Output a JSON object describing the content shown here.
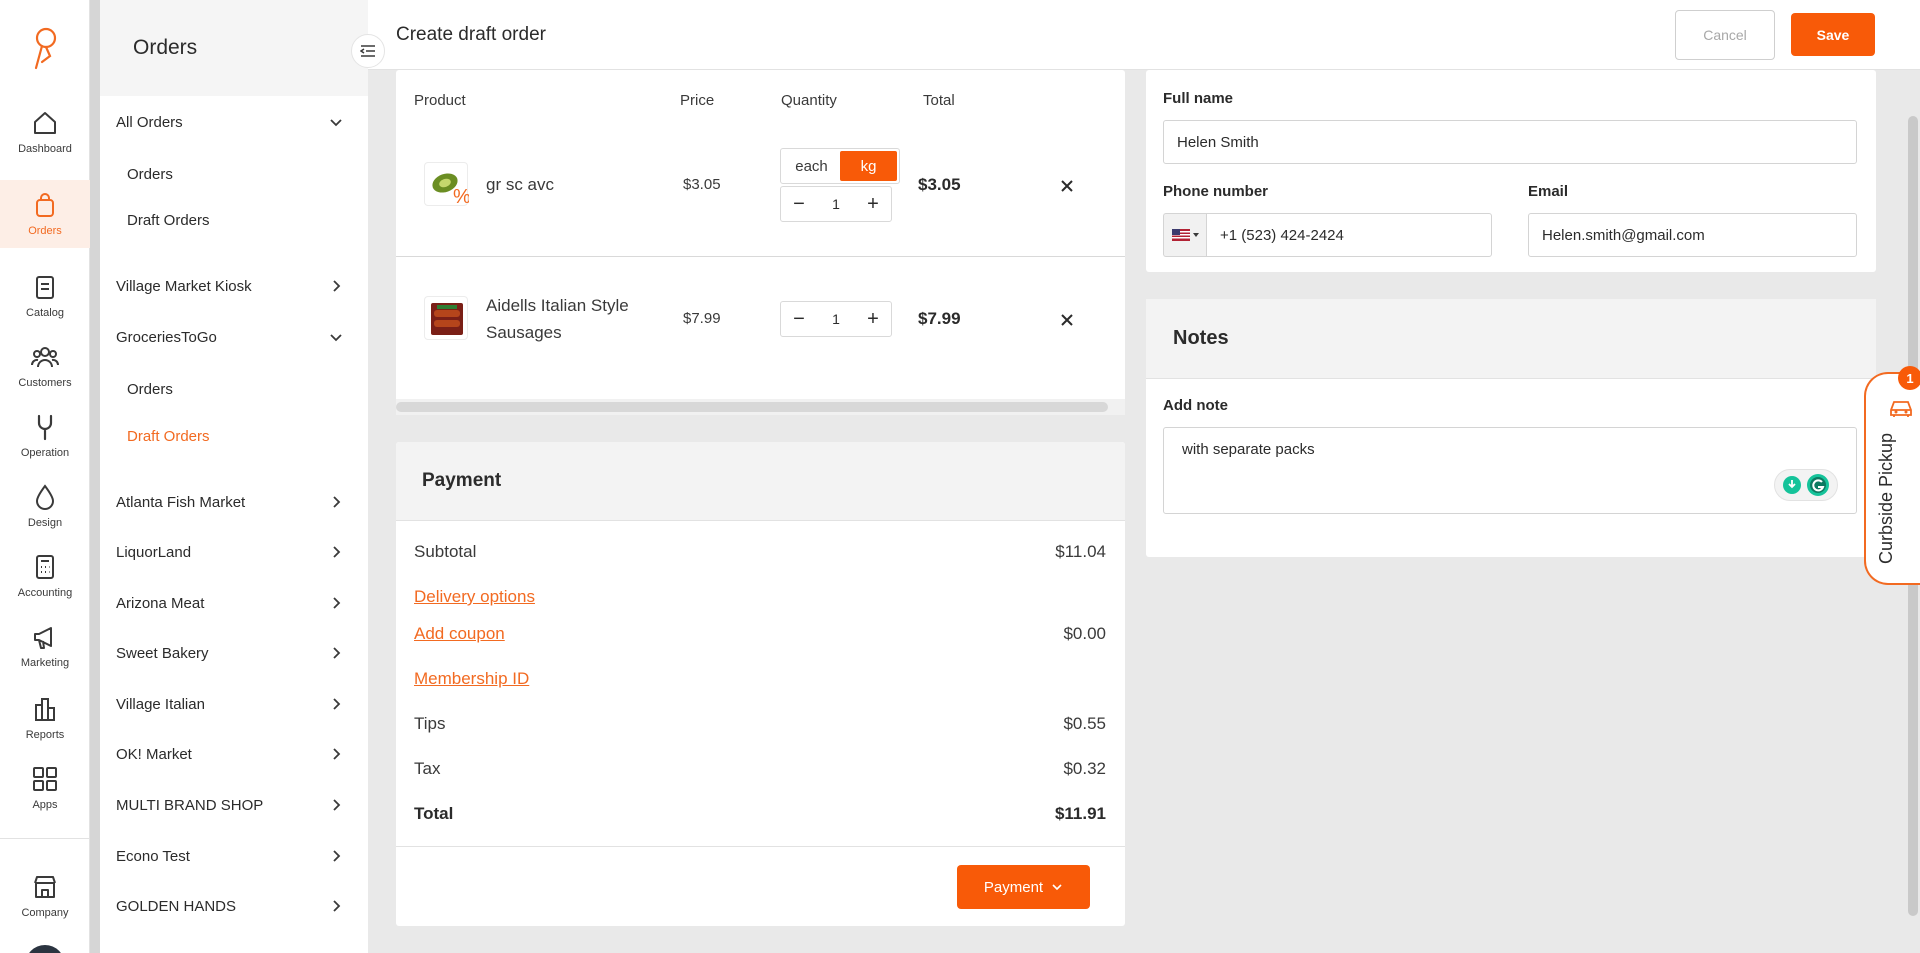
{
  "colors": {
    "accent": "#f85a08",
    "accent_text": "#f26a21"
  },
  "rail": {
    "items": [
      {
        "label": "Dashboard",
        "icon": "home-icon"
      },
      {
        "label": "Orders",
        "icon": "shopping-bag-icon",
        "active": true
      },
      {
        "label": "Catalog",
        "icon": "catalog-icon"
      },
      {
        "label": "Customers",
        "icon": "customers-icon"
      },
      {
        "label": "Operation",
        "icon": "wrench-icon"
      },
      {
        "label": "Design",
        "icon": "droplet-icon"
      },
      {
        "label": "Accounting",
        "icon": "calculator-icon"
      },
      {
        "label": "Marketing",
        "icon": "megaphone-icon"
      },
      {
        "label": "Reports",
        "icon": "bar-chart-icon"
      },
      {
        "label": "Apps",
        "icon": "apps-grid-icon"
      }
    ],
    "company": {
      "label": "Company",
      "icon": "store-icon"
    }
  },
  "sidebar": {
    "title": "Orders",
    "groups": [
      {
        "label": "All Orders",
        "expanded": true,
        "children": [
          "Orders",
          "Draft Orders"
        ]
      },
      {
        "label": "Village Market Kiosk",
        "expanded": false
      },
      {
        "label": "GroceriesToGo",
        "expanded": true,
        "children": [
          "Orders",
          "Draft Orders"
        ],
        "active_child": "Draft Orders"
      },
      {
        "label": "Atlanta Fish Market",
        "expanded": false
      },
      {
        "label": "LiquorLand",
        "expanded": false
      },
      {
        "label": "Arizona Meat",
        "expanded": false
      },
      {
        "label": "Sweet Bakery",
        "expanded": false
      },
      {
        "label": "Village Italian",
        "expanded": false
      },
      {
        "label": "OK! Market",
        "expanded": false
      },
      {
        "label": "MULTI BRAND SHOP",
        "expanded": false
      },
      {
        "label": "Econo Test",
        "expanded": false
      },
      {
        "label": "GOLDEN HANDS",
        "expanded": false
      }
    ]
  },
  "header": {
    "title": "Create draft order",
    "cancel_label": "Cancel",
    "save_label": "Save"
  },
  "products": {
    "columns": {
      "product": "Product",
      "price": "Price",
      "quantity": "Quantity",
      "total": "Total"
    },
    "rows": [
      {
        "name": "gr sc avc",
        "price": "$3.05",
        "qty": "1",
        "total": "$3.05",
        "units": [
          "each",
          "kg"
        ],
        "selected_unit": "kg"
      },
      {
        "name": "Aidells Italian Style Sausages",
        "price": "$7.99",
        "qty": "1",
        "total": "$7.99"
      }
    ]
  },
  "payment": {
    "title": "Payment",
    "subtotal_label": "Subtotal",
    "subtotal_value": "$11.04",
    "delivery_label": "Delivery options",
    "coupon_label": "Add coupon",
    "coupon_value": "$0.00",
    "membership_label": "Membership ID",
    "tips_label": "Tips",
    "tips_value": "$0.55",
    "tax_label": "Tax",
    "tax_value": "$0.32",
    "total_label": "Total",
    "total_value": "$11.91",
    "button_label": "Payment"
  },
  "customer": {
    "fullname_label": "Full name",
    "fullname_value": "Helen Smith",
    "phone_label": "Phone number",
    "phone_value": "+1 (523) 424-2424",
    "email_label": "Email",
    "email_value": "Helen.smith@gmail.com"
  },
  "notes": {
    "title": "Notes",
    "add_label": "Add note",
    "note_value": "with separate packs"
  },
  "curbside": {
    "label": "Curbside Pickup",
    "badge": "1"
  }
}
